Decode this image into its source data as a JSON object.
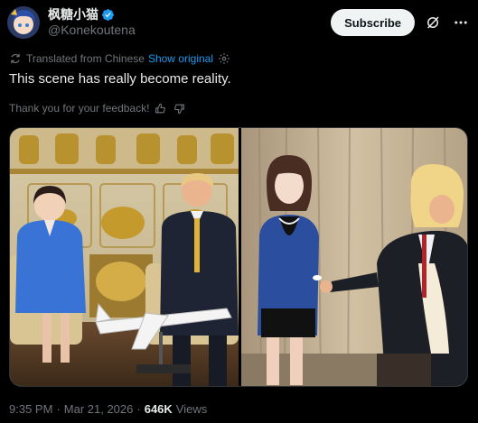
{
  "author": {
    "display_name": "枫糖小猫",
    "handle": "@Konekoutena",
    "verified": true
  },
  "header": {
    "subscribe_label": "Subscribe",
    "grok_icon": "grok-icon",
    "more_icon": "more-icon"
  },
  "translation": {
    "label": "Translated from Chinese",
    "show_original": "Show original",
    "settings_icon": "gear-icon"
  },
  "tweet": {
    "text": "This scene has really become reality.",
    "feedback_text": "Thank you for your feedback!"
  },
  "meta": {
    "time": "9:35 PM",
    "date": "Mar 21, 2026",
    "separator": "·",
    "views_count": "646K",
    "views_label": "Views"
  },
  "colors": {
    "background": "#000000",
    "text": "#e7e9ea",
    "muted": "#71767b",
    "link": "#1d9bf0",
    "verified": "#1d9bf0"
  }
}
